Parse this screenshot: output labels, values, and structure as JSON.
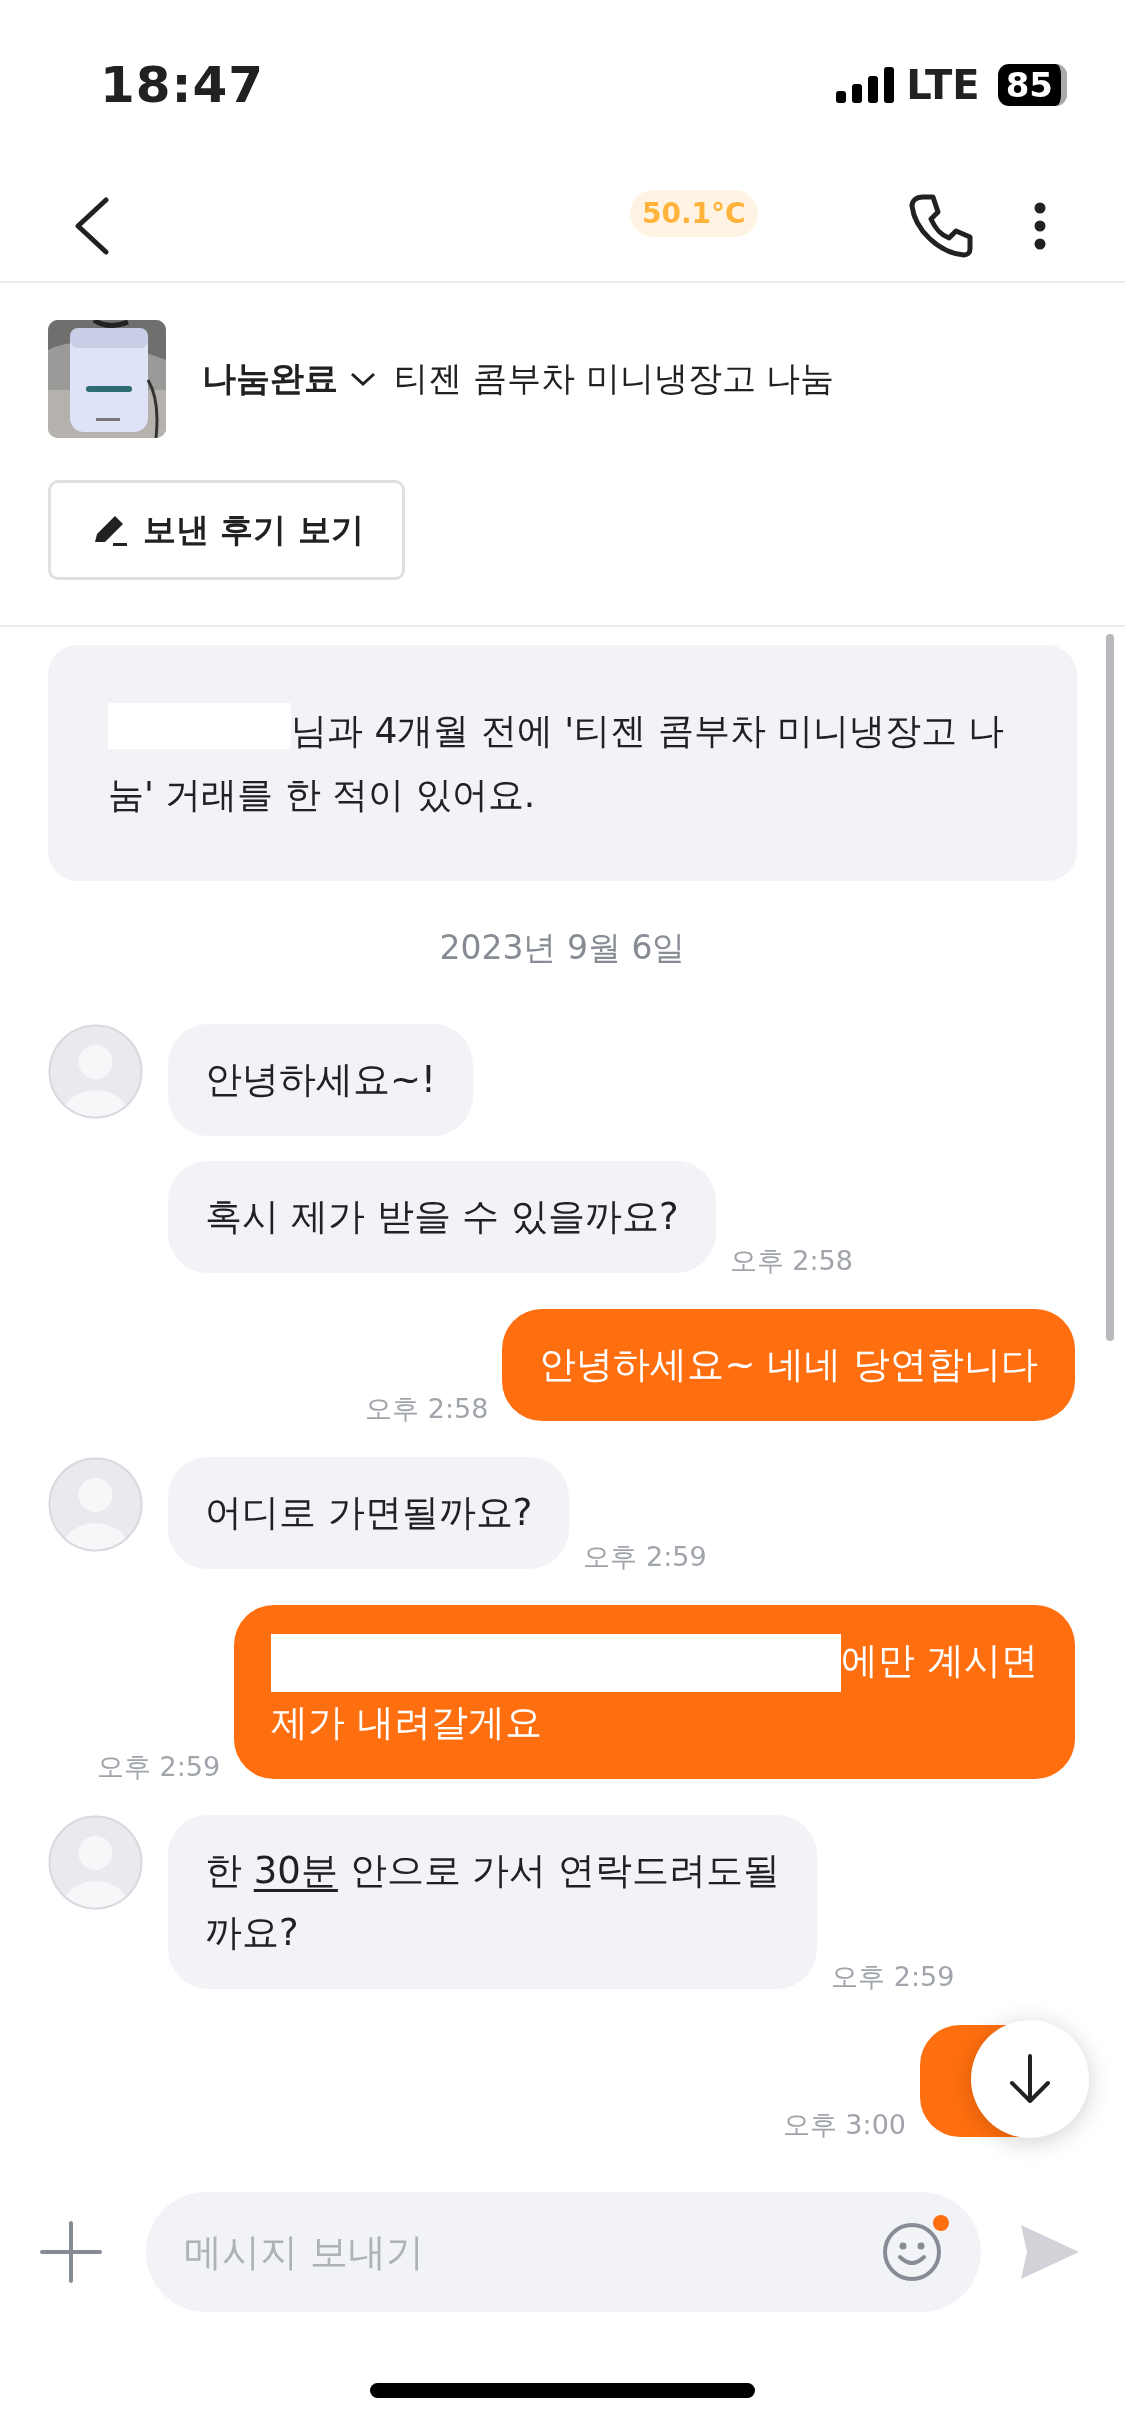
{
  "status_bar": {
    "time": "18:47",
    "network": "LTE",
    "battery": "85"
  },
  "header": {
    "temperature": "50.1°C"
  },
  "product": {
    "status": "나눔완료",
    "title": "티젠 콤부차 미니냉장고 나눔",
    "review_button": "보낸 후기 보기"
  },
  "notice": {
    "redacted": true,
    "text": "님과 4개월 전에 '티젠 콤부차 미니냉장고 나눔' 거래를 한 적이 있어요."
  },
  "date": "2023년 9월 6일",
  "messages": [
    {
      "kind": "incoming",
      "avatar": true,
      "lines": [
        "안녕하세요~!"
      ]
    },
    {
      "kind": "incoming",
      "avatar": false,
      "lines": [
        "혹시 제가 받을 수 있을까요?"
      ],
      "time": "오후 2:58"
    },
    {
      "kind": "outgoing",
      "lines": [
        "안녕하세요~ 네네 당연합니다"
      ],
      "time": "오후 2:58"
    },
    {
      "kind": "incoming",
      "avatar": true,
      "lines": [
        "어디로 가면될까요?"
      ],
      "time": "오후 2:59"
    },
    {
      "kind": "outgoing",
      "redacted": true,
      "lines": [
        "에만 계시면",
        "제가 내려갈게요"
      ],
      "time": "오후 2:59"
    },
    {
      "kind": "incoming",
      "avatar": true,
      "lines": [
        [
          {
            "text": "한 ",
            "underline": false
          },
          {
            "text": "30분",
            "underline": true
          },
          {
            "text": " 안으로 가서 연락드려도될",
            "underline": false
          }
        ],
        [
          {
            "text": "까요?",
            "underline": false
          }
        ]
      ],
      "time": "오후 2:59"
    },
    {
      "kind": "outgoing",
      "time": "오후 3:00"
    }
  ],
  "input": {
    "placeholder": "메시지 보내기",
    "emoji_badge": true
  }
}
